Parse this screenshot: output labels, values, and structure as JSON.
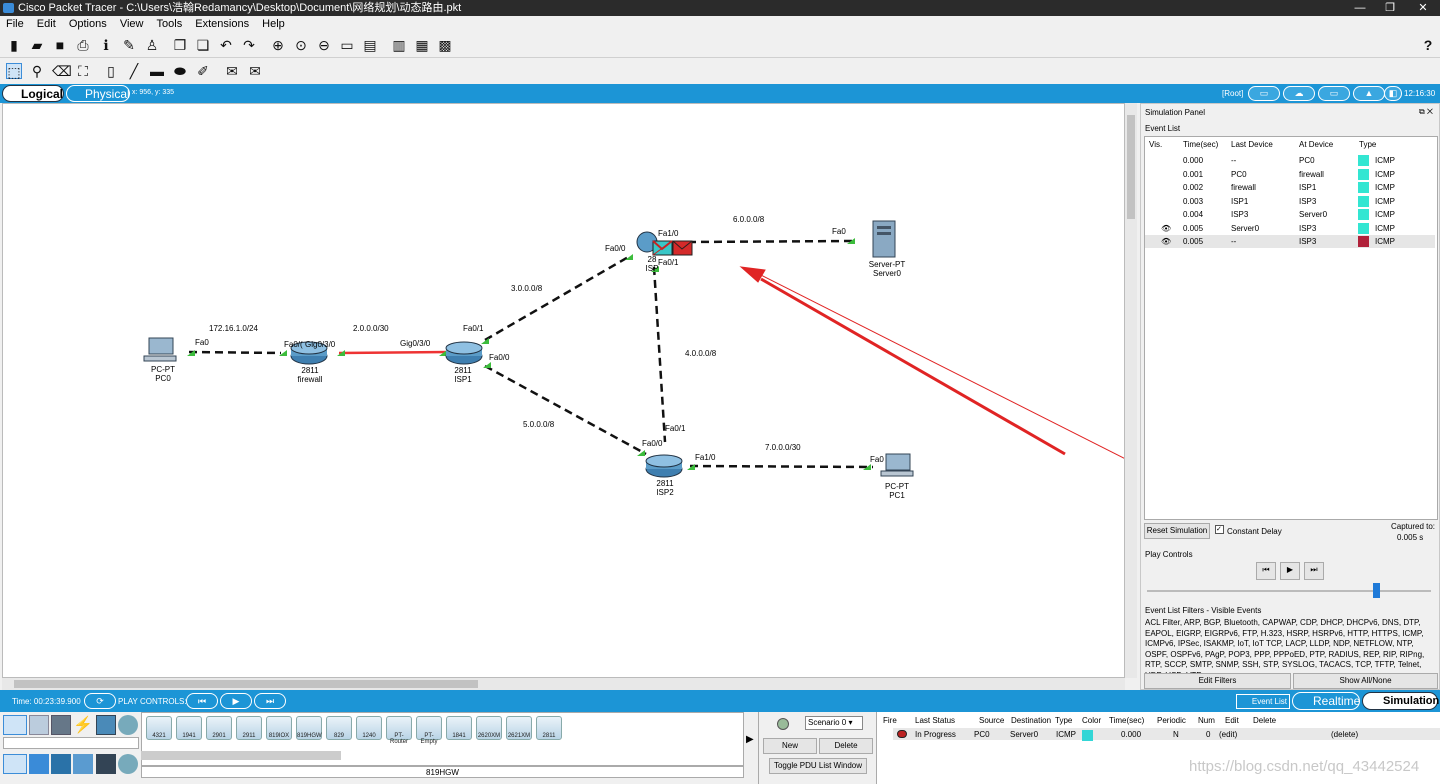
{
  "window": {
    "title": "Cisco Packet Tracer - C:\\Users\\浩翰Redamancy\\Desktop\\Document\\网络规划\\动态路由.pkt",
    "min": "—",
    "max": "❐",
    "close": "✕"
  },
  "menu": [
    "File",
    "Edit",
    "Options",
    "View",
    "Tools",
    "Extensions",
    "Help"
  ],
  "toolbar1": [
    "new-icon",
    "open-icon",
    "save-icon",
    "print-icon",
    "info-icon",
    "wizard-icon",
    "network-icon",
    "copy-icon",
    "paste-icon",
    "undo-icon",
    "redo-icon",
    "zoom-in-icon",
    "zoom-reset-icon",
    "zoom-out-icon",
    "window-icon",
    "palette-icon",
    "cluster-icon",
    "device-icon",
    "image-icon"
  ],
  "toolbar1_help": "?",
  "toolbar2": [
    "select-icon",
    "inspect-icon",
    "delete-icon",
    "resize-icon",
    "note-icon",
    "line-icon",
    "rect-icon",
    "ellipse-icon",
    "freeform-icon",
    "pdu-simple-icon",
    "pdu-complex-icon"
  ],
  "modebar": {
    "logical": "Logical",
    "physical": "Physical",
    "coords": "x: 956, y: 335",
    "root": "[Root]",
    "clock": "12:16:30"
  },
  "topology": {
    "devices": [
      {
        "id": "pc0",
        "model": "PC-PT",
        "name": "PC0"
      },
      {
        "id": "fw",
        "model": "2811",
        "name": "firewall"
      },
      {
        "id": "isp1",
        "model": "2811",
        "name": "ISP1"
      },
      {
        "id": "isp2",
        "model": "2811",
        "name": "ISP2"
      },
      {
        "id": "isp3",
        "model": "28",
        "name": "ISP"
      },
      {
        "id": "server0",
        "model": "Server-PT",
        "name": "Server0"
      },
      {
        "id": "pc1",
        "model": "PC-PT",
        "name": "PC1"
      }
    ],
    "networks": [
      "172.16.1.0/24",
      "2.0.0.0/30",
      "3.0.0.0/8",
      "4.0.0.0/8",
      "5.0.0.0/8",
      "6.0.0.0/8",
      "7.0.0.0/30"
    ],
    "ports": [
      "Fa0",
      "Fa0/(",
      "Gig0/3/0",
      "Gig0/3/0",
      "Fa0/1",
      "Fa0/0",
      "Fa0/0",
      "Fa1/0",
      "Fa0/1",
      "Fa0",
      "Fa0/1",
      "Fa0/0",
      "Fa1/0",
      "Fa0"
    ]
  },
  "sim": {
    "panel_title": "Simulation Panel",
    "event_list": "Event List",
    "headers": [
      "Vis.",
      "Time(sec)",
      "Last Device",
      "At Device",
      "Type"
    ],
    "events": [
      {
        "vis": "",
        "time": "0.000",
        "last": "--",
        "at": "PC0",
        "type": "ICMP",
        "color": "#33e6d2"
      },
      {
        "vis": "",
        "time": "0.001",
        "last": "PC0",
        "at": "firewall",
        "type": "ICMP",
        "color": "#33e6d2"
      },
      {
        "vis": "",
        "time": "0.002",
        "last": "firewall",
        "at": "ISP1",
        "type": "ICMP",
        "color": "#33e6d2"
      },
      {
        "vis": "",
        "time": "0.003",
        "last": "ISP1",
        "at": "ISP3",
        "type": "ICMP",
        "color": "#33e6d2"
      },
      {
        "vis": "",
        "time": "0.004",
        "last": "ISP3",
        "at": "Server0",
        "type": "ICMP",
        "color": "#33e6d2"
      },
      {
        "vis": "eye",
        "time": "0.005",
        "last": "Server0",
        "at": "ISP3",
        "type": "ICMP",
        "color": "#33e6d2"
      },
      {
        "vis": "eye",
        "time": "0.005",
        "last": "--",
        "at": "ISP3",
        "type": "ICMP",
        "color": "#b0213a"
      }
    ],
    "reset": "Reset Simulation",
    "constant_delay": "Constant Delay",
    "captured_label": "Captured to:",
    "captured_value": "0.005 s",
    "play_controls": "Play Controls",
    "filters_title": "Event List Filters - Visible Events",
    "filters_text": "ACL Filter, ARP, BGP, Bluetooth, CAPWAP, CDP, DHCP, DHCPv6, DNS, DTP, EAPOL, EIGRP, EIGRPv6, FTP, H.323, HSRP, HSRPv6, HTTP, HTTPS, ICMP, ICMPv6, IPSec, ISAKMP, IoT, IoT TCP, LACP, LLDP, NDP, NETFLOW, NTP, OSPF, OSPFv6, PAgP, POP3, PPP, PPPoED, PTP, RADIUS, REP, RIP, RIPng, RTP, SCCP, SMTP, SNMP, SSH, STP, SYSLOG, TACACS, TCP, TFTP, Telnet, UDP, USB, VTP",
    "edit_filters": "Edit Filters",
    "show_all": "Show All/None"
  },
  "bottom": {
    "time": "Time: 00:23:39.900",
    "play_controls": "PLAY CONTROLS:",
    "event_list": "Event List",
    "realtime": "Realtime",
    "simulation": "Simulation",
    "models": [
      "4321",
      "1941",
      "2901",
      "2911",
      "819IOX",
      "819HGW",
      "829",
      "1240",
      "PT-Router",
      "PT-Empty",
      "1841",
      "2620XM",
      "2621XM",
      "2811"
    ],
    "selected_model": "819HGW",
    "scenario": "Scenario 0",
    "new": "New",
    "delete": "Delete",
    "toggle": "Toggle PDU List Window",
    "pdu_headers": [
      "Fire",
      "Last Status",
      "Source",
      "Destination",
      "Type",
      "Color",
      "Time(sec)",
      "Periodic",
      "Num",
      "Edit",
      "Delete"
    ],
    "pdu_row": {
      "status": "In Progress",
      "source": "PC0",
      "dest": "Server0",
      "type": "ICMP",
      "color": "#33d6d6",
      "time": "0.000",
      "periodic": "N",
      "num": "0",
      "edit": "(edit)",
      "delete": "(delete)"
    },
    "watermark": "https://blog.csdn.net/qq_43442524"
  }
}
